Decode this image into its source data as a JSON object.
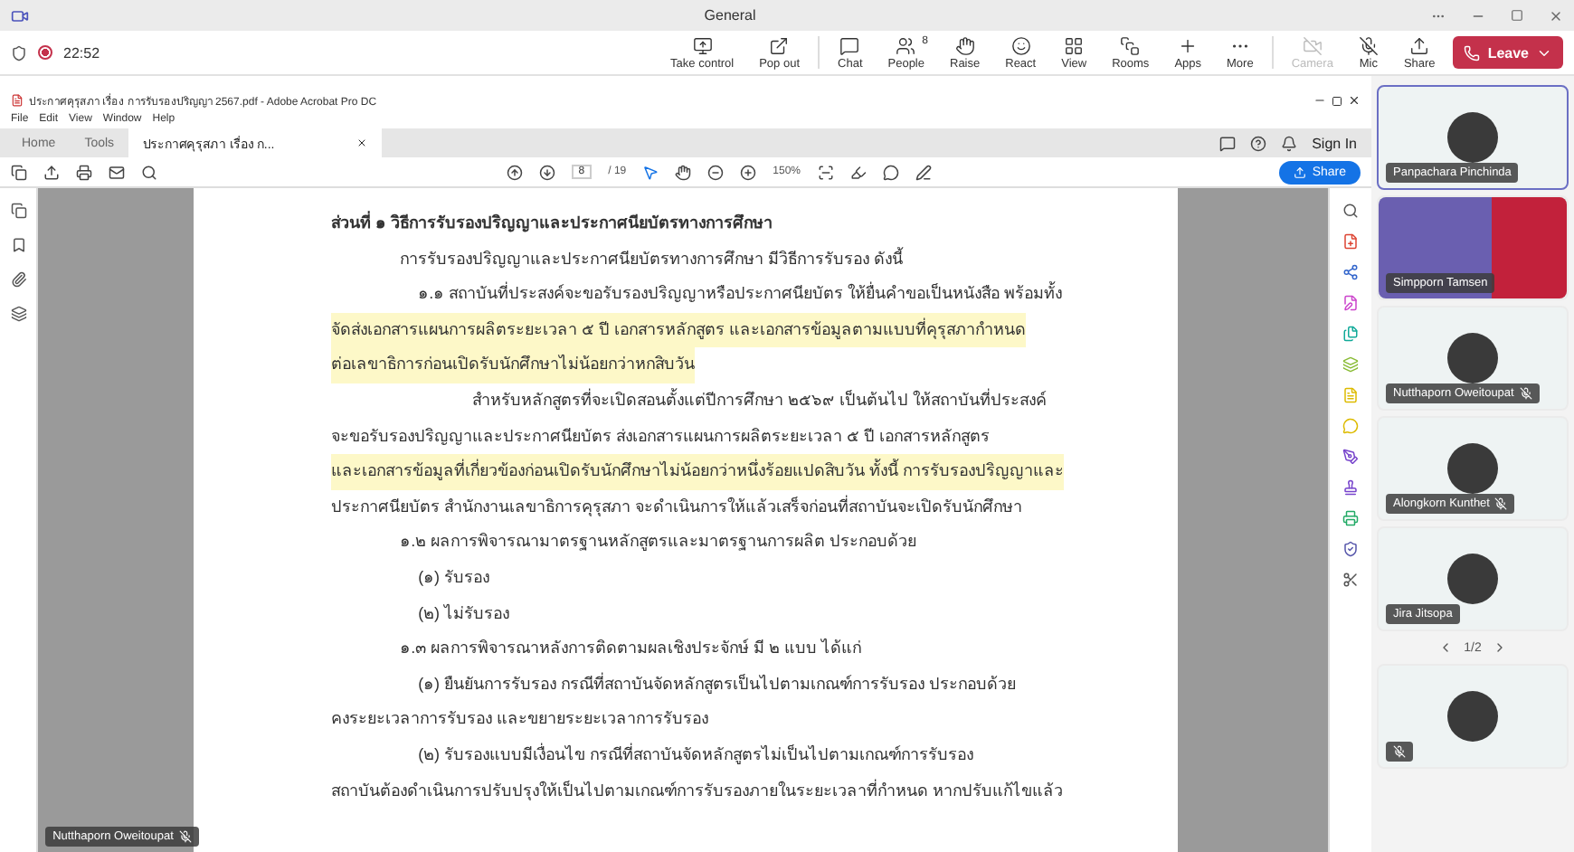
{
  "teams": {
    "title": "General",
    "time": "22:52",
    "recording": true,
    "actions": [
      {
        "kind": "take-control",
        "label": "Take control"
      },
      {
        "kind": "pop-out",
        "label": "Pop out"
      },
      {
        "kind": "sep"
      },
      {
        "kind": "chat",
        "label": "Chat"
      },
      {
        "kind": "people",
        "label": "People",
        "badge": "8"
      },
      {
        "kind": "raise",
        "label": "Raise"
      },
      {
        "kind": "react",
        "label": "React"
      },
      {
        "kind": "view",
        "label": "View"
      },
      {
        "kind": "rooms",
        "label": "Rooms"
      },
      {
        "kind": "apps",
        "label": "Apps"
      },
      {
        "kind": "more",
        "label": "More"
      },
      {
        "kind": "sep"
      },
      {
        "kind": "camera",
        "label": "Camera",
        "disabled": true
      },
      {
        "kind": "mic",
        "label": "Mic",
        "muted": true
      },
      {
        "kind": "share",
        "label": "Share"
      }
    ],
    "leave": "Leave"
  },
  "acrobat": {
    "title": "ประกาศคุรุสภา เรื่อง การรับรองปริญญา 2567.pdf - Adobe Acrobat Pro DC",
    "menu": [
      "File",
      "Edit",
      "View",
      "Window",
      "Help"
    ],
    "tabs": [
      {
        "label": "Home",
        "selected": false
      },
      {
        "label": "Tools",
        "selected": false
      },
      {
        "label": "ประกาศคุรุสภา เรื่อง ก...",
        "selected": true
      }
    ],
    "sign_in": "Sign In",
    "page": "8",
    "pages": "/ 19",
    "zoom": "150%",
    "share": "Share"
  },
  "document": {
    "lines": [
      {
        "kind": "heading",
        "text": "ส่วนที่ ๑ วิธีการรับรองปริญญาและประกาศนียบัตรทางการศึกษา",
        "highlight": false
      },
      {
        "kind": "indent1",
        "text": "การรับรองปริญญาและประกาศนียบัตรทางการศึกษา มีวิธีการรับรอง ดังนี้",
        "highlight": false
      },
      {
        "kind": "indent2",
        "text": "๑.๑ สถาบันที่ประสงค์จะขอรับรองปริญญาหรือประกาศนียบัตร ให้ยื่นคำขอเป็นหนังสือ พร้อมทั้ง",
        "highlight": false
      },
      {
        "kind": "plain",
        "text": "จัดส่งเอกสารแผนการผลิตระยะเวลา ๕ ปี เอกสารหลักสูตร และเอกสารข้อมูลตามแบบที่คุรุสภากำหนด",
        "highlight": true
      },
      {
        "kind": "plain",
        "text": "ต่อเลขาธิการก่อนเปิดรับนักศึกษาไม่น้อยกว่าหกสิบวัน",
        "highlight": true
      },
      {
        "kind": "indent3",
        "text": "สำหรับหลักสูตรที่จะเปิดสอนตั้งแต่ปีการศึกษา ๒๕๖๙ เป็นต้นไป ให้สถาบันที่ประสงค์",
        "highlight": false
      },
      {
        "kind": "plain",
        "text": "จะขอรับรองปริญญาและประกาศนียบัตร ส่งเอกสารแผนการผลิตระยะเวลา ๕ ปี เอกสารหลักสูตร",
        "highlight": false
      },
      {
        "kind": "plain",
        "text": "และเอกสารข้อมูลที่เกี่ยวข้องก่อนเปิดรับนักศึกษาไม่น้อยกว่าหนึ่งร้อยแปดสิบวัน ทั้งนี้ การรับรองปริญญาและ",
        "highlight": true
      },
      {
        "kind": "plain",
        "text": "ประกาศนียบัตร สำนักงานเลขาธิการคุรุสภา จะดำเนินการให้แล้วเสร็จก่อนที่สถาบันจะเปิดรับนักศึกษา",
        "highlight": false
      },
      {
        "kind": "indent1",
        "text": "๑.๒ ผลการพิจารณามาตรฐานหลักสูตรและมาตรฐานการผลิต ประกอบด้วย",
        "highlight": false
      },
      {
        "kind": "indent2",
        "text": "(๑) รับรอง",
        "highlight": false
      },
      {
        "kind": "indent2",
        "text": "(๒) ไม่รับรอง",
        "highlight": false
      },
      {
        "kind": "indent1",
        "text": "๑.๓ ผลการพิจารณาหลังการติดตามผลเชิงประจักษ์ มี ๒ แบบ ได้แก่",
        "highlight": false
      },
      {
        "kind": "indent2",
        "text": "(๑) ยืนยันการรับรอง กรณีที่สถาบันจัดหลักสูตรเป็นไปตามเกณฑ์การรับรอง ประกอบด้วย",
        "highlight": false
      },
      {
        "kind": "plain",
        "text": "คงระยะเวลาการรับรอง และขยายระยะเวลาการรับรอง",
        "highlight": false
      },
      {
        "kind": "indent2",
        "text": "(๒) รับรองแบบมีเงื่อนไข กรณีที่สถาบันจัดหลักสูตรไม่เป็นไปตามเกณฑ์การรับรอง",
        "highlight": false
      },
      {
        "kind": "plain",
        "text": "สถาบันต้องดำเนินการปรับปรุงให้เป็นไปตามเกณฑ์การรับรองภายในระยะเวลาที่กำหนด หากปรับแก้ไขแล้ว",
        "highlight": false
      }
    ]
  },
  "presenter": {
    "name": "Nutthaporn Oweitoupat",
    "muted": true
  },
  "participants": [
    {
      "name": "Panpachara Pinchinda",
      "kind": "avatar",
      "selected": true,
      "muted": false
    },
    {
      "name": "Simpporn Tamsen",
      "kind": "video",
      "selected": false,
      "muted": false
    },
    {
      "name": "Nutthaporn Oweitoupat",
      "kind": "avatar",
      "selected": false,
      "muted": true
    },
    {
      "name": "Alongkorn Kunthet",
      "kind": "avatar",
      "selected": false,
      "muted": true
    },
    {
      "name": "Jira Jitsopa",
      "kind": "avatar",
      "selected": false,
      "muted": false
    }
  ],
  "pager": "1/2",
  "more_participants": [
    {
      "kind": "avatar",
      "selected": false,
      "muted": true
    }
  ]
}
